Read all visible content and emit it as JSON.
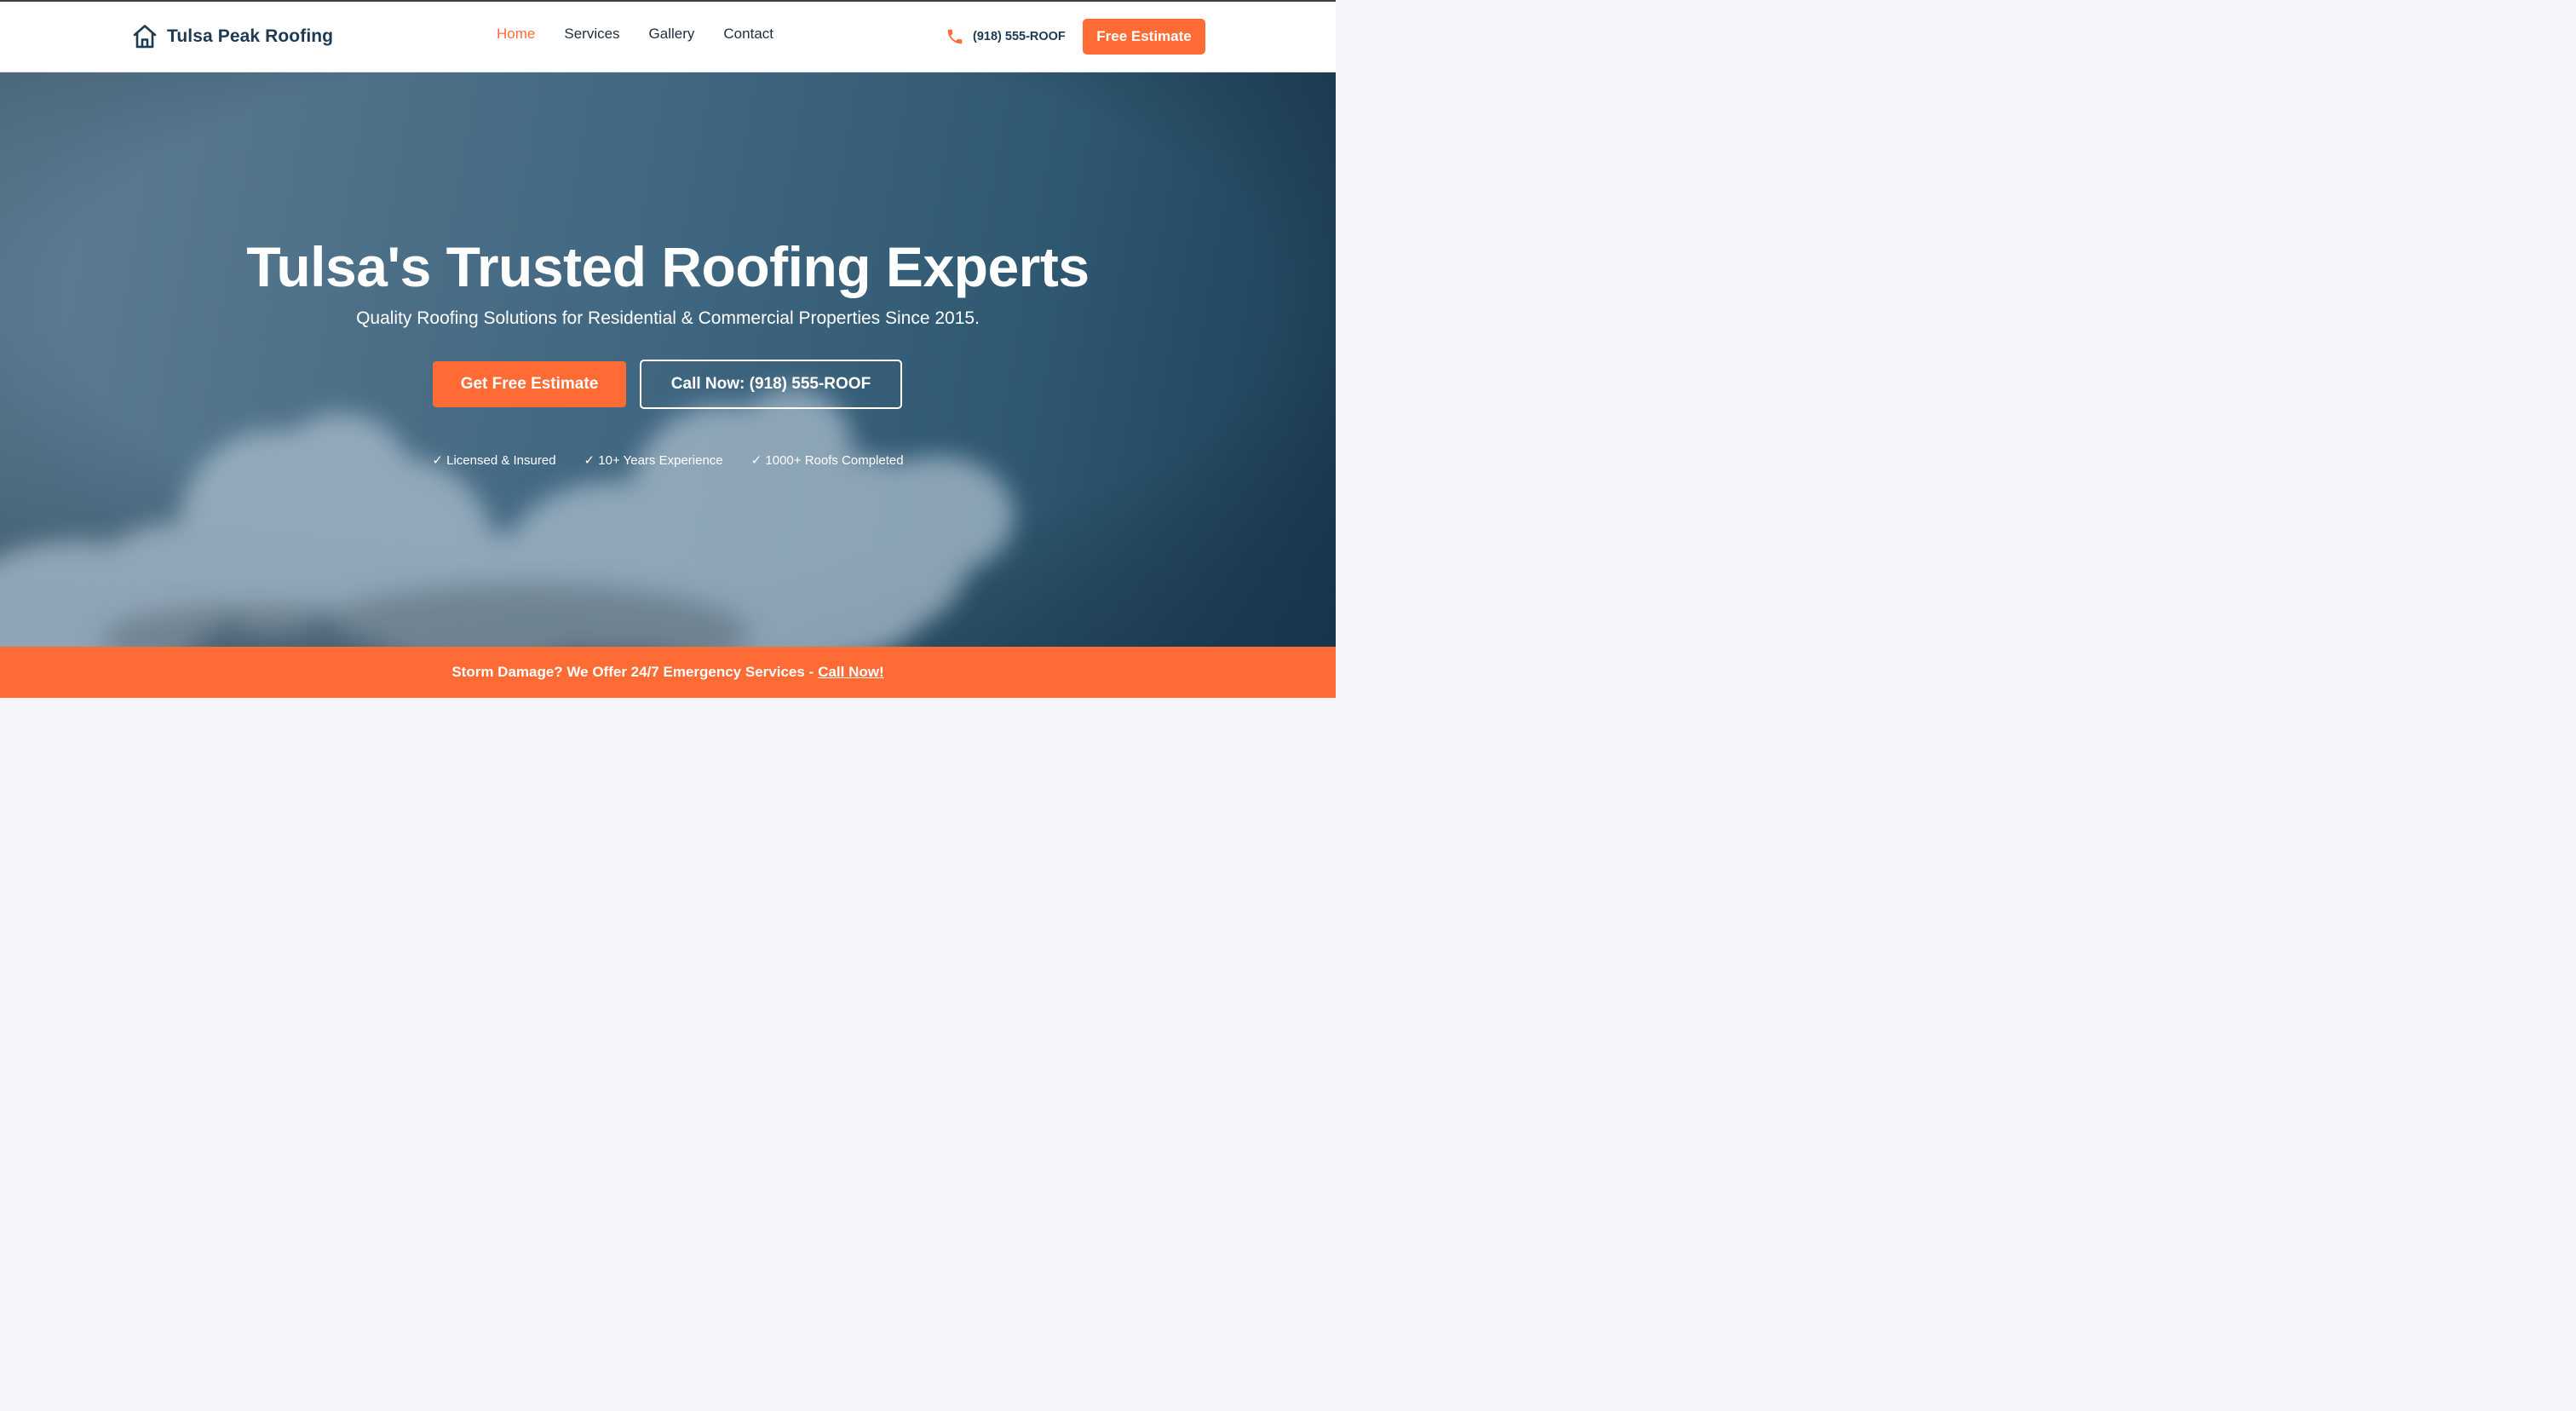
{
  "header": {
    "brand_name": "Tulsa Peak Roofing",
    "nav": [
      {
        "label": "Home",
        "active": true
      },
      {
        "label": "Services",
        "active": false
      },
      {
        "label": "Gallery",
        "active": false
      },
      {
        "label": "Contact",
        "active": false
      }
    ],
    "phone": "(918) 555-ROOF",
    "cta_label": "Free Estimate"
  },
  "hero": {
    "title": "Tulsa's Trusted Roofing Experts",
    "subtitle": "Quality Roofing Solutions for Residential & Commercial Properties Since 2015.",
    "primary_button": "Get Free Estimate",
    "secondary_button": "Call Now: (918) 555-ROOF",
    "features": [
      "✓ Licensed & Insured",
      "✓ 10+ Years Experience",
      "✓ 1000+ Roofs Completed"
    ]
  },
  "banner": {
    "text": "Storm Damage? We Offer 24/7 Emergency Services -",
    "link": "Call Now!"
  },
  "icons": {
    "brand": "house-icon",
    "phone": "phone-icon"
  },
  "colors": {
    "accent": "#ff6b35",
    "brand_text": "#1e3a52",
    "hero_dark": "#1d3f58",
    "hero_light": "#5f7f95"
  }
}
